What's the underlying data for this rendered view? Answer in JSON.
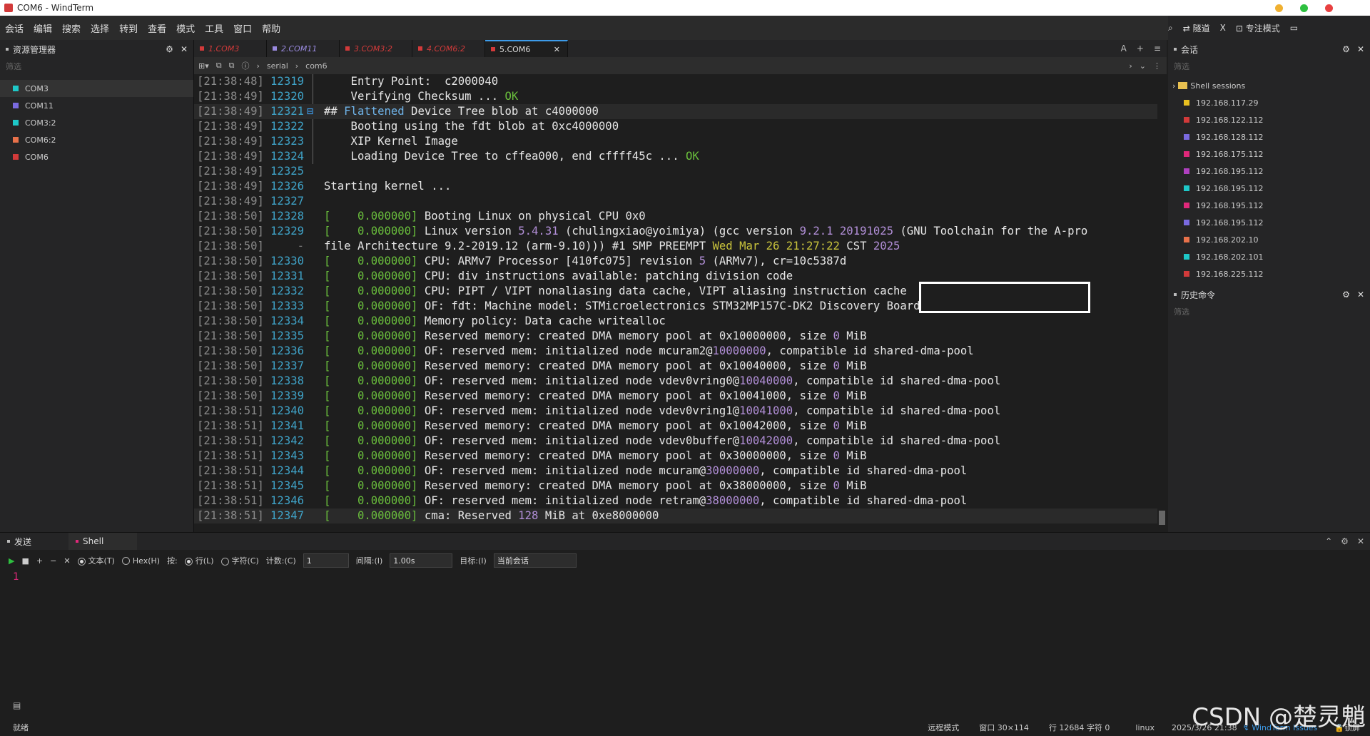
{
  "window": {
    "title": "COM6 - WindTerm"
  },
  "menu": [
    "会话",
    "编辑",
    "搜索",
    "选择",
    "转到",
    "查看",
    "模式",
    "工具",
    "窗口",
    "帮助"
  ],
  "menu_right": {
    "tunnel": "隧道",
    "focus": "专注模式"
  },
  "explorer": {
    "title": "资源管理器",
    "filter": "筛选",
    "items": [
      {
        "label": "COM3",
        "color": "#1ec8c8"
      },
      {
        "label": "COM11",
        "color": "#7a6ae0"
      },
      {
        "label": "COM3:2",
        "color": "#1ec8c8"
      },
      {
        "label": "COM6:2",
        "color": "#e8714a"
      },
      {
        "label": "COM6",
        "color": "#d23a3a"
      }
    ]
  },
  "tabs": [
    {
      "label": "1.COM3",
      "color": "#d23a3a"
    },
    {
      "label": "2.COM11",
      "color": "#9a8ae0"
    },
    {
      "label": "3.COM3:2",
      "color": "#d23a3a"
    },
    {
      "label": "4.COM6:2",
      "color": "#d23a3a"
    },
    {
      "label": "5.COM6",
      "color": "#d23a3a"
    }
  ],
  "address": {
    "part1": "serial",
    "part2": "com6"
  },
  "terminal": [
    {
      "ts": "[21:38:48]",
      "ln": "12319",
      "segs": [
        [
          "txt",
          "    Entry Point:  c2000040"
        ]
      ]
    },
    {
      "ts": "[21:38:49]",
      "ln": "12320",
      "segs": [
        [
          "txt",
          "    Verifying Checksum ... "
        ],
        [
          "g",
          "OK"
        ]
      ]
    },
    {
      "ts": "[21:38:49]",
      "ln": "12321",
      "hl": true,
      "segs": [
        [
          "txt",
          "## "
        ],
        [
          "b",
          "Flattened"
        ],
        [
          "txt",
          " Device Tree blob at c4000000"
        ]
      ]
    },
    {
      "ts": "[21:38:49]",
      "ln": "12322",
      "segs": [
        [
          "txt",
          "    Booting using the fdt blob at 0xc4000000"
        ]
      ]
    },
    {
      "ts": "[21:38:49]",
      "ln": "12323",
      "segs": [
        [
          "txt",
          "    XIP Kernel Image"
        ]
      ]
    },
    {
      "ts": "[21:38:49]",
      "ln": "12324",
      "segs": [
        [
          "txt",
          "    Loading Device Tree to cffea000, end cffff45c ... "
        ],
        [
          "g",
          "OK"
        ]
      ]
    },
    {
      "ts": "[21:38:49]",
      "ln": "12325",
      "segs": []
    },
    {
      "ts": "[21:38:49]",
      "ln": "12326",
      "segs": [
        [
          "txt",
          "Starting kernel ..."
        ]
      ]
    },
    {
      "ts": "[21:38:49]",
      "ln": "12327",
      "segs": []
    },
    {
      "ts": "[21:38:50]",
      "ln": "12328",
      "segs": [
        [
          "g",
          "[    0.000000]"
        ],
        [
          "txt",
          " Booting Linux on physical CPU 0x0"
        ]
      ]
    },
    {
      "ts": "[21:38:50]",
      "ln": "12329",
      "segs": [
        [
          "g",
          "[    0.000000]"
        ],
        [
          "txt",
          " Linux version "
        ],
        [
          "p",
          "5.4.31"
        ],
        [
          "txt",
          " (chulingxiao@yoimiya) (gcc version "
        ],
        [
          "p",
          "9.2.1 20191025"
        ],
        [
          "txt",
          " (GNU Toolchain for the A-pro"
        ]
      ]
    },
    {
      "ts": "[21:38:50]",
      "ln": "-",
      "segs": [
        [
          "txt",
          "file Architecture 9.2-2019.12 (arm-9.10))) #1 SMP PREEMPT "
        ],
        [
          "y",
          "Wed Mar 26 21:27:22"
        ],
        [
          "txt",
          " CST "
        ],
        [
          "p",
          "2025"
        ]
      ]
    },
    {
      "ts": "[21:38:50]",
      "ln": "12330",
      "segs": [
        [
          "g",
          "[    0.000000]"
        ],
        [
          "txt",
          " CPU: ARMv7 Processor [410fc075] revision "
        ],
        [
          "p",
          "5"
        ],
        [
          "txt",
          " (ARMv7), cr=10c5387d"
        ]
      ]
    },
    {
      "ts": "[21:38:50]",
      "ln": "12331",
      "segs": [
        [
          "g",
          "[    0.000000]"
        ],
        [
          "txt",
          " CPU: div instructions available: patching division code"
        ]
      ]
    },
    {
      "ts": "[21:38:50]",
      "ln": "12332",
      "segs": [
        [
          "g",
          "[    0.000000]"
        ],
        [
          "txt",
          " CPU: PIPT / VIPT nonaliasing data cache, VIPT aliasing instruction cache"
        ]
      ]
    },
    {
      "ts": "[21:38:50]",
      "ln": "12333",
      "segs": [
        [
          "g",
          "[    0.000000]"
        ],
        [
          "txt",
          " OF: fdt: Machine model: STMicroelectronics STM32MP157C-DK2 Discovery Board"
        ]
      ]
    },
    {
      "ts": "[21:38:50]",
      "ln": "12334",
      "segs": [
        [
          "g",
          "[    0.000000]"
        ],
        [
          "txt",
          " Memory policy: Data cache writealloc"
        ]
      ]
    },
    {
      "ts": "[21:38:50]",
      "ln": "12335",
      "segs": [
        [
          "g",
          "[    0.000000]"
        ],
        [
          "txt",
          " Reserved memory: created DMA memory pool at 0x10000000, size "
        ],
        [
          "p",
          "0"
        ],
        [
          "txt",
          " MiB"
        ]
      ]
    },
    {
      "ts": "[21:38:50]",
      "ln": "12336",
      "segs": [
        [
          "g",
          "[    0.000000]"
        ],
        [
          "txt",
          " OF: reserved mem: initialized node mcuram2@"
        ],
        [
          "p",
          "10000000"
        ],
        [
          "txt",
          ", compatible id shared-dma-pool"
        ]
      ]
    },
    {
      "ts": "[21:38:50]",
      "ln": "12337",
      "segs": [
        [
          "g",
          "[    0.000000]"
        ],
        [
          "txt",
          " Reserved memory: created DMA memory pool at 0x10040000, size "
        ],
        [
          "p",
          "0"
        ],
        [
          "txt",
          " MiB"
        ]
      ]
    },
    {
      "ts": "[21:38:50]",
      "ln": "12338",
      "segs": [
        [
          "g",
          "[    0.000000]"
        ],
        [
          "txt",
          " OF: reserved mem: initialized node vdev0vring0@"
        ],
        [
          "p",
          "10040000"
        ],
        [
          "txt",
          ", compatible id shared-dma-pool"
        ]
      ]
    },
    {
      "ts": "[21:38:50]",
      "ln": "12339",
      "segs": [
        [
          "g",
          "[    0.000000]"
        ],
        [
          "txt",
          " Reserved memory: created DMA memory pool at 0x10041000, size "
        ],
        [
          "p",
          "0"
        ],
        [
          "txt",
          " MiB"
        ]
      ]
    },
    {
      "ts": "[21:38:51]",
      "ln": "12340",
      "segs": [
        [
          "g",
          "[    0.000000]"
        ],
        [
          "txt",
          " OF: reserved mem: initialized node vdev0vring1@"
        ],
        [
          "p",
          "10041000"
        ],
        [
          "txt",
          ", compatible id shared-dma-pool"
        ]
      ]
    },
    {
      "ts": "[21:38:51]",
      "ln": "12341",
      "segs": [
        [
          "g",
          "[    0.000000]"
        ],
        [
          "txt",
          " Reserved memory: created DMA memory pool at 0x10042000, size "
        ],
        [
          "p",
          "0"
        ],
        [
          "txt",
          " MiB"
        ]
      ]
    },
    {
      "ts": "[21:38:51]",
      "ln": "12342",
      "segs": [
        [
          "g",
          "[    0.000000]"
        ],
        [
          "txt",
          " OF: reserved mem: initialized node vdev0buffer@"
        ],
        [
          "p",
          "10042000"
        ],
        [
          "txt",
          ", compatible id shared-dma-pool"
        ]
      ]
    },
    {
      "ts": "[21:38:51]",
      "ln": "12343",
      "segs": [
        [
          "g",
          "[    0.000000]"
        ],
        [
          "txt",
          " Reserved memory: created DMA memory pool at 0x30000000, size "
        ],
        [
          "p",
          "0"
        ],
        [
          "txt",
          " MiB"
        ]
      ]
    },
    {
      "ts": "[21:38:51]",
      "ln": "12344",
      "segs": [
        [
          "g",
          "[    0.000000]"
        ],
        [
          "txt",
          " OF: reserved mem: initialized node mcuram@"
        ],
        [
          "p",
          "30000000"
        ],
        [
          "txt",
          ", compatible id shared-dma-pool"
        ]
      ]
    },
    {
      "ts": "[21:38:51]",
      "ln": "12345",
      "segs": [
        [
          "g",
          "[    0.000000]"
        ],
        [
          "txt",
          " Reserved memory: created DMA memory pool at 0x38000000, size "
        ],
        [
          "p",
          "0"
        ],
        [
          "txt",
          " MiB"
        ]
      ]
    },
    {
      "ts": "[21:38:51]",
      "ln": "12346",
      "segs": [
        [
          "g",
          "[    0.000000]"
        ],
        [
          "txt",
          " OF: reserved mem: initialized node retram@"
        ],
        [
          "p",
          "38000000"
        ],
        [
          "txt",
          ", compatible id shared-dma-pool"
        ]
      ]
    },
    {
      "ts": "[21:38:51]",
      "ln": "12347",
      "hl": true,
      "segs": [
        [
          "g",
          "[    0.000000]"
        ],
        [
          "txt",
          " cma: Reserved "
        ],
        [
          "p",
          "128"
        ],
        [
          "txt",
          " MiB at "
        ],
        [
          "txt",
          "0xe8000000"
        ]
      ]
    }
  ],
  "sessions": {
    "title": "会话",
    "filter": "筛选",
    "folder": "Shell sessions",
    "items": [
      {
        "label": "192.168.117.29",
        "color": "#e8c020"
      },
      {
        "label": "192.168.122.112",
        "color": "#d23a3a"
      },
      {
        "label": "192.168.128.112",
        "color": "#7a6ae0"
      },
      {
        "label": "192.168.175.112",
        "color": "#e0287a"
      },
      {
        "label": "192.168.195.112",
        "color": "#b040c0"
      },
      {
        "label": "192.168.195.112",
        "color": "#1ec8c8"
      },
      {
        "label": "192.168.195.112",
        "color": "#e0287a"
      },
      {
        "label": "192.168.195.112",
        "color": "#7a6ae0"
      },
      {
        "label": "192.168.202.10",
        "color": "#e8714a"
      },
      {
        "label": "192.168.202.101",
        "color": "#1ec8c8"
      },
      {
        "label": "192.168.225.112",
        "color": "#d23a3a"
      }
    ]
  },
  "history": {
    "title": "历史命令",
    "filter": "筛选"
  },
  "send": {
    "tab1": "发送",
    "tab2": "Shell",
    "text_mode": "文本(T)",
    "hex_mode": "Hex(H)",
    "by": "按:",
    "line": "行(L)",
    "char": "字符(C)",
    "count_label": "计数:(C)",
    "count": "1",
    "interval_label": "间隔:(I)",
    "interval": "1.00s",
    "target_label": "目标:(I)",
    "target": "当前会话",
    "line_number": "1"
  },
  "status": {
    "ready": "就绪",
    "remote": "远程模式",
    "window": "窗口 30×114",
    "pos": "行 12684 字符 0",
    "os": "linux",
    "datetime": "2025/3/26 21:38",
    "issues": "WindTerm Issues",
    "lock": "锁屏"
  },
  "watermark": "CSDN @楚灵魈"
}
